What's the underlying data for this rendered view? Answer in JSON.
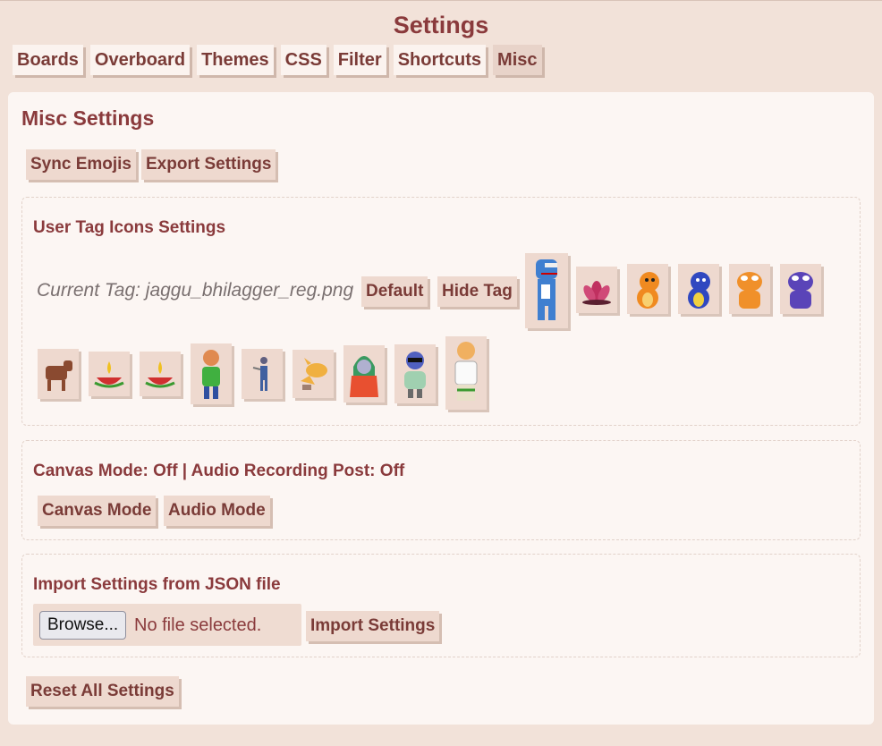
{
  "page": {
    "title": "Settings"
  },
  "tabs": [
    {
      "label": "Boards"
    },
    {
      "label": "Overboard"
    },
    {
      "label": "Themes"
    },
    {
      "label": "CSS"
    },
    {
      "label": "Filter"
    },
    {
      "label": "Shortcuts"
    },
    {
      "label": "Misc",
      "active": true
    }
  ],
  "misc": {
    "title": "Misc Settings",
    "sync_emojis_label": "Sync Emojis",
    "export_settings_label": "Export Settings"
  },
  "user_tag": {
    "title": "User Tag Icons Settings",
    "current_tag_label": "Current Tag: jaggu_bhilagger_reg.png",
    "default_label": "Default",
    "hide_tag_label": "Hide Tag",
    "icons": [
      {
        "name": "blue-pepe-tag-icon"
      },
      {
        "name": "lotus-tag-icon"
      },
      {
        "name": "orange-dino-tag-icon"
      },
      {
        "name": "blue-dino-tag-icon"
      },
      {
        "name": "orange-frog-tag-icon"
      },
      {
        "name": "purple-frog-tag-icon"
      },
      {
        "name": "cow-tag-icon"
      },
      {
        "name": "diya-lamp-tag-icon"
      },
      {
        "name": "diya-lamp-alt-tag-icon"
      },
      {
        "name": "man-green-shirt-tag-icon"
      },
      {
        "name": "blue-figure-tag-icon"
      },
      {
        "name": "orange-cat-tag-icon"
      },
      {
        "name": "old-lady-tag-icon"
      },
      {
        "name": "sunglasses-man-tag-icon"
      },
      {
        "name": "man-white-kurta-tag-icon"
      }
    ]
  },
  "modes": {
    "status_text": "Canvas Mode: Off | Audio Recording Post: Off",
    "canvas_mode_label": "Canvas Mode",
    "audio_mode_label": "Audio Mode"
  },
  "import": {
    "title": "Import Settings from JSON file",
    "browse_label": "Browse...",
    "no_file_text": "No file selected.",
    "import_label": "Import Settings"
  },
  "reset": {
    "label": "Reset All Settings"
  },
  "colors": {
    "background": "#f2e2d9",
    "panel": "#fcf6f3",
    "accent": "#8a3a3c",
    "button": "#eed9cf"
  }
}
